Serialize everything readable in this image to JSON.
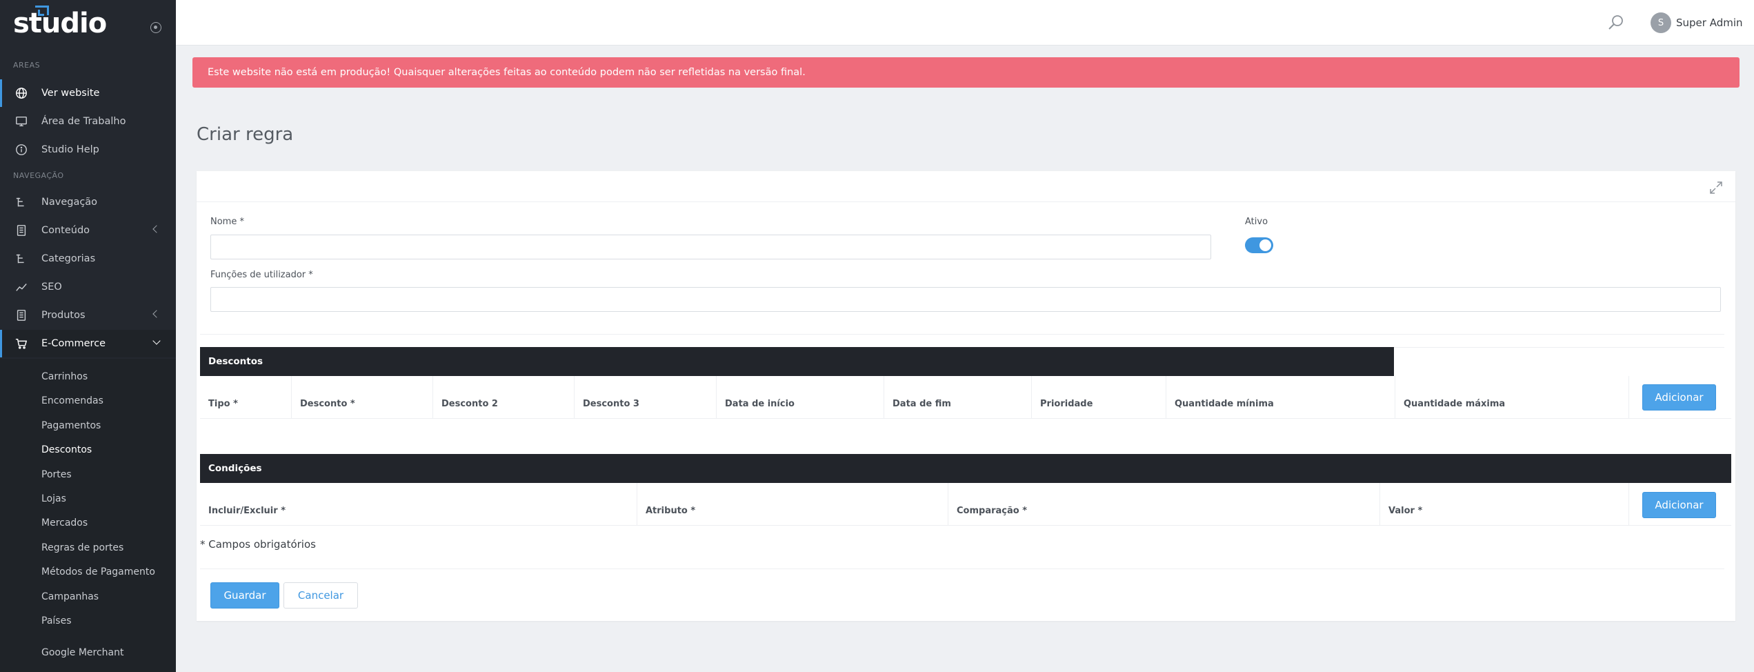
{
  "brand": {
    "name": "studio"
  },
  "sidebar": {
    "section_areas": "AREAS",
    "areas": [
      {
        "label": "Ver website",
        "icon": "globe-icon"
      },
      {
        "label": "Área de Trabalho",
        "icon": "monitor-icon"
      },
      {
        "label": "Studio Help",
        "icon": "info-icon"
      }
    ],
    "section_nav": "NAVEGAÇÃO",
    "nav": [
      {
        "label": "Navegação",
        "icon": "tree-icon"
      },
      {
        "label": "Conteúdo",
        "icon": "document-icon"
      },
      {
        "label": "Categorias",
        "icon": "tree-icon"
      },
      {
        "label": "SEO",
        "icon": "chart-line-icon"
      },
      {
        "label": "Produtos",
        "icon": "document-icon"
      },
      {
        "label": "E-Commerce",
        "icon": "cart-icon"
      }
    ],
    "ecommerce_items": [
      "Carrinhos",
      "Encomendas",
      "Pagamentos",
      "Descontos",
      "Portes",
      "Lojas",
      "Mercados",
      "Regras de portes",
      "Métodos de Pagamento",
      "Campanhas",
      "Países",
      "Google Merchant"
    ]
  },
  "topbar": {
    "avatar_initial": "S",
    "user_name": "Super Admin"
  },
  "alert": {
    "text": "Este website não está em produção! Quaisquer alterações feitas ao conteúdo podem não ser refletidas na versão final."
  },
  "page": {
    "title": "Criar regra"
  },
  "form": {
    "name_label": "Nome *",
    "name_value": "",
    "active_label": "Ativo",
    "active_on": true,
    "roles_label": "Funções de utilizador *",
    "roles_value": ""
  },
  "discounts": {
    "title": "Descontos",
    "columns": [
      "Tipo *",
      "Desconto *",
      "Desconto 2",
      "Desconto 3",
      "Data de início",
      "Data de fim",
      "Prioridade",
      "Quantidade mínima",
      "Quantidade máxima"
    ],
    "add_label": "Adicionar"
  },
  "conditions": {
    "title": "Condições",
    "columns": [
      "Incluir/Excluir *",
      "Atributo *",
      "Comparação *",
      "Valor *"
    ],
    "add_label": "Adicionar"
  },
  "required_note": "* Campos obrigatórios",
  "actions": {
    "save": "Guardar",
    "cancel": "Cancelar"
  },
  "colors": {
    "accent": "#3f97e0",
    "alert": "#ef6b7b",
    "sidebar": "#24282f",
    "dark_bar": "#22252b"
  }
}
